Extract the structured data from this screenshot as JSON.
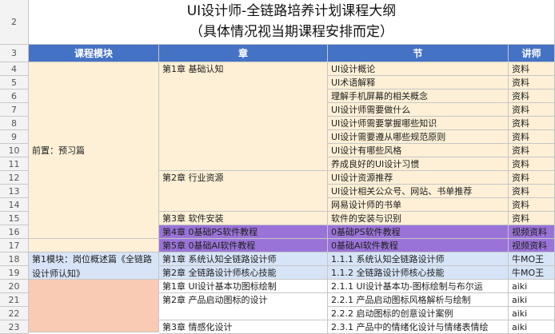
{
  "sheet": {
    "title_line1": "UI设计师-全链路培养计划课程大纲",
    "title_line2": "（具体情况视当期课程安排而定）",
    "headers": {
      "module": "课程模块",
      "chapter": "章",
      "section": "节",
      "lecturer": "讲师"
    },
    "row_numbers": [
      "2",
      "3",
      "4",
      "5",
      "6",
      "7",
      "8",
      "9",
      "10",
      "11",
      "12",
      "13",
      "14",
      "15",
      "16",
      "17",
      "18",
      "19",
      "20",
      "21",
      "22",
      "23"
    ],
    "modules": {
      "prestudy": "前置：预习篇",
      "m1": "第1模块：岗位概述篇《全链路设计师认知》"
    },
    "chapters": {
      "ch1_basic": "第1章 基础认知",
      "ch2_resources": "第2章 行业资源",
      "ch3_software": "第3章   软件安装",
      "ch4_ps": "第4章 0基础PS软件教程",
      "ch5_ai": "第5章 0基础AI软件教程",
      "m1_ch1": "第1章 系统认知全链路设计师",
      "m1_ch2": "第2章 全链路设计师核心技能",
      "icon_ch1": "第1章  UI设计基本功图标绘制",
      "icon_ch2": "第2章   产品启动图标的设计",
      "icon_ch3": "第3章 情感化设计"
    },
    "sections": [
      "UI设计概论",
      "UI术语解释",
      "理解手机屏幕的相关概念",
      "UI设计师需要做什么",
      "UI设计师需要掌握哪些知识",
      "UI设计需要遵从哪些规范原则",
      "UI设计有哪些风格",
      "养成良好的UI设计习惯",
      "UI设计资源推荐",
      "UI设计相关公众号、网站、书单推荐",
      "网易设计师的书单",
      "软件的安装与识别",
      "0基础PS软件教程",
      "0基础AI软件教程",
      "1.1.1  系统认知全链路设计师",
      "1.1.2  全链路设计师核心技能",
      "2.1.1  UI设计基本功-图标绘制与布尔运",
      "2.2.1  产品启动图标风格解析与绘制",
      "2.2.2  启动图标的创意设计案例",
      "2.3.1  产品中的情绪化设计与情绪表情绘"
    ],
    "lecturers": [
      "资料",
      "资料",
      "资料",
      "资料",
      "资料",
      "资料",
      "资料",
      "资料",
      "资料",
      "资料",
      "资料",
      "资料",
      "视频资料",
      "视频资料",
      "牛MO王",
      "牛MO王",
      "aiki",
      "aiki",
      "aiki",
      "aiki"
    ]
  }
}
